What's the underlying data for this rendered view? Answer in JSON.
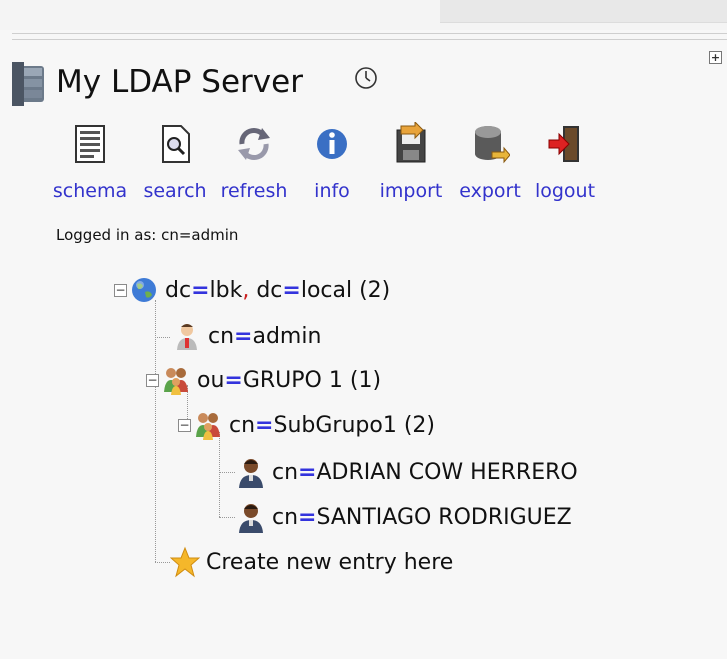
{
  "server": {
    "title": "My LDAP Server",
    "icon": "server-icon",
    "clock_icon": "clock-icon"
  },
  "actions": [
    {
      "key": "schema",
      "label": "schema",
      "icon": "schema-icon"
    },
    {
      "key": "search",
      "label": "search",
      "icon": "search-icon"
    },
    {
      "key": "refresh",
      "label": "refresh",
      "icon": "refresh-icon"
    },
    {
      "key": "info",
      "label": "info",
      "icon": "info-icon"
    },
    {
      "key": "import",
      "label": "import",
      "icon": "import-icon"
    },
    {
      "key": "export",
      "label": "export",
      "icon": "export-icon"
    },
    {
      "key": "logout",
      "label": "logout",
      "icon": "logout-icon"
    }
  ],
  "status": {
    "logged_in": "Logged in as: cn=admin"
  },
  "tree": {
    "root": {
      "attr1": "dc",
      "val1": "lbk",
      "attr2": "dc",
      "val2": "local",
      "count": "(2)"
    },
    "admin": {
      "attr": "cn",
      "val": "admin"
    },
    "grupo": {
      "attr": "ou",
      "val": "GRUPO 1",
      "count": "(1)"
    },
    "subgrupo": {
      "attr": "cn",
      "val": "SubGrupo1",
      "count": "(2)"
    },
    "user1": {
      "attr": "cn",
      "val": "ADRIAN COW HERRERO"
    },
    "user2": {
      "attr": "cn",
      "val": "SANTIAGO RODRIGUEZ"
    },
    "create": {
      "label": "Create new entry here"
    }
  },
  "colors": {
    "link": "#3333cc",
    "equals": "#3333dd",
    "comma": "#cc2222"
  }
}
